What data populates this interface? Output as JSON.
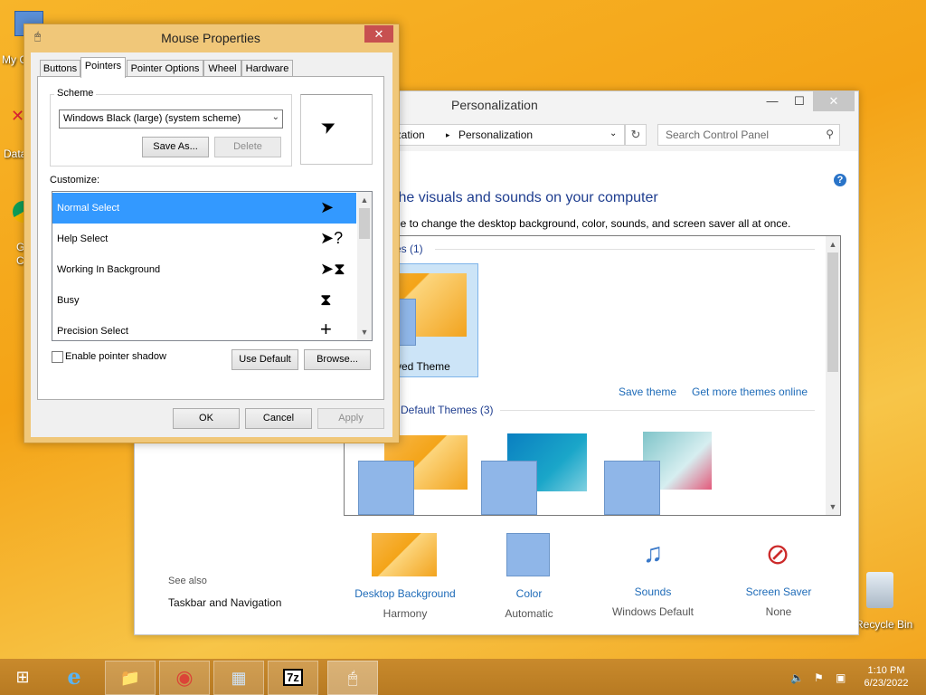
{
  "desktop": {
    "icons": [
      {
        "label": "My C",
        "icon": "computer-icon"
      },
      {
        "label": "Data",
        "icon": "folder-shortcut-icon"
      },
      {
        "label": "G\nC",
        "icon": "chrome-icon"
      },
      {
        "label": "Recycle Bin",
        "icon": "recycle-bin-icon"
      }
    ]
  },
  "personalization": {
    "title": "Personalization",
    "window_buttons": {
      "minimize": "—",
      "maximize": "☐",
      "close": "✕"
    },
    "address": {
      "crumb_parent": "ization",
      "crumb_current": "Personalization",
      "separator": "▸"
    },
    "search": {
      "placeholder": "Search Control Panel"
    },
    "help": "?",
    "heading": "the visuals and sounds on your computer",
    "subheading": "ne to change the desktop background, color, sounds, and screen saver all at once.",
    "themes_panel": {
      "my_themes_header": "es (1)",
      "unsaved_theme": "ved Theme",
      "save_theme_link": "Save theme",
      "get_more_link": "Get more themes online",
      "default_header": "Default Themes (3)"
    },
    "see_also": {
      "label": "See also",
      "link": "Taskbar and Navigation"
    },
    "bottom_items": [
      {
        "label": "Desktop Background",
        "sub": "Harmony",
        "icon": "desktop-background-icon"
      },
      {
        "label": "Color",
        "sub": "Automatic",
        "icon": "color-icon"
      },
      {
        "label": "Sounds",
        "sub": "Windows Default",
        "icon": "sounds-icon"
      },
      {
        "label": "Screen Saver",
        "sub": "None",
        "icon": "screen-saver-icon"
      }
    ]
  },
  "mouse_properties": {
    "title": "Mouse Properties",
    "close": "✕",
    "tabs": [
      "Buttons",
      "Pointers",
      "Pointer Options",
      "Wheel",
      "Hardware"
    ],
    "active_tab": "Pointers",
    "scheme_label": "Scheme",
    "scheme_value": "Windows Black (large) (system scheme)",
    "save_as": "Save As...",
    "delete": "Delete",
    "customize_label": "Customize:",
    "pointers": [
      {
        "name": "Normal Select",
        "cursor": "arrow-cursor-icon",
        "glyph": "➤"
      },
      {
        "name": "Help Select",
        "cursor": "help-cursor-icon",
        "glyph": "➤?"
      },
      {
        "name": "Working In Background",
        "cursor": "working-cursor-icon",
        "glyph": "➤⧗"
      },
      {
        "name": "Busy",
        "cursor": "busy-cursor-icon",
        "glyph": "⧗"
      },
      {
        "name": "Precision Select",
        "cursor": "crosshair-cursor-icon",
        "glyph": "+"
      }
    ],
    "enable_shadow": "Enable pointer shadow",
    "use_default": "Use Default",
    "browse": "Browse...",
    "ok": "OK",
    "cancel": "Cancel",
    "apply": "Apply"
  },
  "taskbar": {
    "items": [
      {
        "name": "start-button",
        "glyph": "⊞"
      },
      {
        "name": "internet-explorer-icon",
        "glyph": "e"
      },
      {
        "name": "file-explorer-icon",
        "glyph": "📁"
      },
      {
        "name": "chrome-icon",
        "glyph": "◉"
      },
      {
        "name": "control-panel-icon",
        "glyph": "▦"
      },
      {
        "name": "7zip-icon",
        "glyph": "7z"
      },
      {
        "name": "mouse-icon",
        "glyph": "🖱"
      }
    ],
    "clock": {
      "time": "1:10 PM",
      "date": "6/23/2022"
    }
  }
}
